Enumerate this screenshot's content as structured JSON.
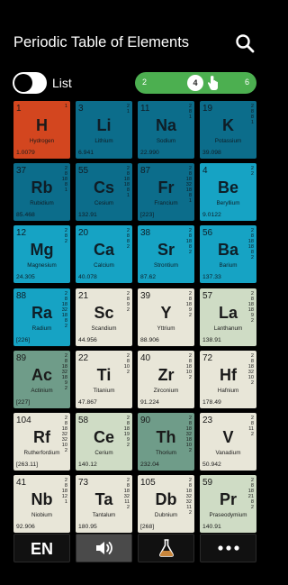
{
  "header": {
    "title": "Periodic Table of Elements"
  },
  "controls": {
    "list_label": "List",
    "list_toggle_on": false,
    "columns_slider": {
      "min": "2",
      "max": "6",
      "value": "4"
    }
  },
  "elements": [
    {
      "number": "1",
      "symbol": "H",
      "name": "Hydrogen",
      "mass": "1.0079",
      "shells": [
        "1"
      ],
      "category": "c-h"
    },
    {
      "number": "3",
      "symbol": "Li",
      "name": "Lithium",
      "mass": "6.941",
      "shells": [
        "2",
        "1"
      ],
      "category": "c-alk"
    },
    {
      "number": "11",
      "symbol": "Na",
      "name": "Sodium",
      "mass": "22.990",
      "shells": [
        "2",
        "8",
        "1"
      ],
      "category": "c-alk"
    },
    {
      "number": "19",
      "symbol": "K",
      "name": "Potassium",
      "mass": "39.098",
      "shells": [
        "2",
        "8",
        "8",
        "1"
      ],
      "category": "c-alk"
    },
    {
      "number": "37",
      "symbol": "Rb",
      "name": "Rubidium",
      "mass": "85.468",
      "shells": [
        "2",
        "8",
        "18",
        "8",
        "1"
      ],
      "category": "c-alk"
    },
    {
      "number": "55",
      "symbol": "Cs",
      "name": "Cesium",
      "mass": "132.91",
      "shells": [
        "2",
        "8",
        "18",
        "18",
        "8",
        "1"
      ],
      "category": "c-alk"
    },
    {
      "number": "87",
      "symbol": "Fr",
      "name": "Francium",
      "mass": "[223]",
      "shells": [
        "2",
        "8",
        "18",
        "32",
        "18",
        "8",
        "1"
      ],
      "category": "c-alk"
    },
    {
      "number": "4",
      "symbol": "Be",
      "name": "Beryllium",
      "mass": "9.0122",
      "shells": [
        "2",
        "2"
      ],
      "category": "c-ae"
    },
    {
      "number": "12",
      "symbol": "Mg",
      "name": "Magnesium",
      "mass": "24.305",
      "shells": [
        "2",
        "8",
        "2"
      ],
      "category": "c-ae"
    },
    {
      "number": "20",
      "symbol": "Ca",
      "name": "Calcium",
      "mass": "40.078",
      "shells": [
        "2",
        "8",
        "8",
        "2"
      ],
      "category": "c-ae"
    },
    {
      "number": "38",
      "symbol": "Sr",
      "name": "Strontium",
      "mass": "87.62",
      "shells": [
        "2",
        "8",
        "18",
        "8",
        "2"
      ],
      "category": "c-ae"
    },
    {
      "number": "56",
      "symbol": "Ba",
      "name": "Barium",
      "mass": "137.33",
      "shells": [
        "2",
        "8",
        "18",
        "18",
        "8",
        "2"
      ],
      "category": "c-ae"
    },
    {
      "number": "88",
      "symbol": "Ra",
      "name": "Radium",
      "mass": "[226]",
      "shells": [
        "2",
        "8",
        "18",
        "32",
        "18",
        "8",
        "2"
      ],
      "category": "c-ae"
    },
    {
      "number": "21",
      "symbol": "Sc",
      "name": "Scandium",
      "mass": "44.956",
      "shells": [
        "2",
        "8",
        "9",
        "2"
      ],
      "category": "c-tm"
    },
    {
      "number": "39",
      "symbol": "Y",
      "name": "Yttrium",
      "mass": "88.906",
      "shells": [
        "2",
        "8",
        "18",
        "9",
        "2"
      ],
      "category": "c-tm"
    },
    {
      "number": "57",
      "symbol": "La",
      "name": "Lanthanum",
      "mass": "138.91",
      "shells": [
        "2",
        "8",
        "18",
        "18",
        "9",
        "2"
      ],
      "category": "c-lan"
    },
    {
      "number": "89",
      "symbol": "Ac",
      "name": "Actinium",
      "mass": "[227]",
      "shells": [
        "2",
        "8",
        "18",
        "32",
        "18",
        "9",
        "2"
      ],
      "category": "c-act"
    },
    {
      "number": "22",
      "symbol": "Ti",
      "name": "Titanium",
      "mass": "47.867",
      "shells": [
        "2",
        "8",
        "10",
        "2"
      ],
      "category": "c-tm"
    },
    {
      "number": "40",
      "symbol": "Zr",
      "name": "Zirconium",
      "mass": "91.224",
      "shells": [
        "2",
        "8",
        "18",
        "10",
        "2"
      ],
      "category": "c-tm"
    },
    {
      "number": "72",
      "symbol": "Hf",
      "name": "Hafnium",
      "mass": "178.49",
      "shells": [
        "2",
        "8",
        "18",
        "32",
        "10",
        "2"
      ],
      "category": "c-tm"
    },
    {
      "number": "104",
      "symbol": "Rf",
      "name": "Rutherfordium",
      "mass": "[263.11]",
      "shells": [
        "2",
        "8",
        "18",
        "32",
        "32",
        "10",
        "2"
      ],
      "category": "c-tm"
    },
    {
      "number": "58",
      "symbol": "Ce",
      "name": "Cerium",
      "mass": "140.12",
      "shells": [
        "2",
        "8",
        "18",
        "19",
        "9",
        "2"
      ],
      "category": "c-lan"
    },
    {
      "number": "90",
      "symbol": "Th",
      "name": "Thorium",
      "mass": "232.04",
      "shells": [
        "2",
        "8",
        "18",
        "32",
        "18",
        "10",
        "2"
      ],
      "category": "c-act"
    },
    {
      "number": "23",
      "symbol": "V",
      "name": "Vanadium",
      "mass": "50.942",
      "shells": [
        "2",
        "8",
        "11",
        "2"
      ],
      "category": "c-tm"
    },
    {
      "number": "41",
      "symbol": "Nb",
      "name": "Niobium",
      "mass": "92.906",
      "shells": [
        "2",
        "8",
        "18",
        "12",
        "1"
      ],
      "category": "c-tm"
    },
    {
      "number": "73",
      "symbol": "Ta",
      "name": "Tantalum",
      "mass": "180.95",
      "shells": [
        "2",
        "8",
        "18",
        "32",
        "11",
        "2"
      ],
      "category": "c-tm"
    },
    {
      "number": "105",
      "symbol": "Db",
      "name": "Dubnium",
      "mass": "[268]",
      "shells": [
        "2",
        "8",
        "18",
        "32",
        "32",
        "11",
        "2"
      ],
      "category": "c-tm"
    },
    {
      "number": "59",
      "symbol": "Pr",
      "name": "Praseodymium",
      "mass": "140.91",
      "shells": [
        "2",
        "8",
        "18",
        "21",
        "8",
        "2"
      ],
      "category": "c-lan"
    }
  ],
  "bottom_tabs": [
    {
      "id": "language",
      "label": "EN",
      "active": false
    },
    {
      "id": "sound",
      "icon": "speaker-icon",
      "active": true
    },
    {
      "id": "lab",
      "icon": "flask-icon",
      "active": false
    },
    {
      "id": "more",
      "icon": "more-icon",
      "active": false
    }
  ]
}
